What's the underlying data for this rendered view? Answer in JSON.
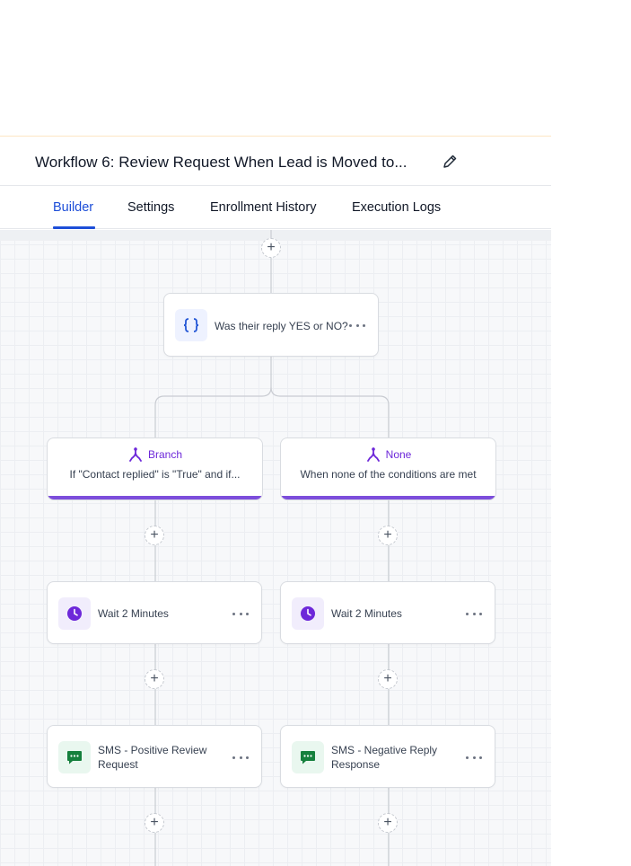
{
  "workflow": {
    "title": "Workflow 6: Review Request When Lead is Moved to..."
  },
  "tabs": [
    {
      "label": "Builder",
      "active": true
    },
    {
      "label": "Settings",
      "active": false
    },
    {
      "label": "Enrollment History",
      "active": false
    },
    {
      "label": "Execution Logs",
      "active": false
    }
  ],
  "nodes": {
    "condition": {
      "label": "Was their reply YES or NO?",
      "icon": "braces-icon"
    },
    "branch_left": {
      "title": "Branch",
      "description": "If \"Contact replied\" is \"True\" and if...",
      "icon": "branch-icon"
    },
    "branch_right": {
      "title": "None",
      "description": "When none of the conditions are met",
      "icon": "branch-icon"
    },
    "wait_left": {
      "label": "Wait 2 Minutes",
      "icon": "clock-icon"
    },
    "wait_right": {
      "label": "Wait 2 Minutes",
      "icon": "clock-icon"
    },
    "sms_left": {
      "label_line1": "SMS - Positive Review",
      "label_line2": "Request",
      "icon": "sms-icon"
    },
    "sms_right": {
      "label_line1": "SMS - Negative Reply",
      "label_line2": "Response",
      "icon": "sms-icon"
    }
  },
  "add_step_symbol": "+",
  "colors": {
    "accent_blue": "#1d4ed8",
    "branch_purple": "#7c4ddb",
    "sms_green": "#15803d",
    "clock_purple": "#6d28d9"
  }
}
